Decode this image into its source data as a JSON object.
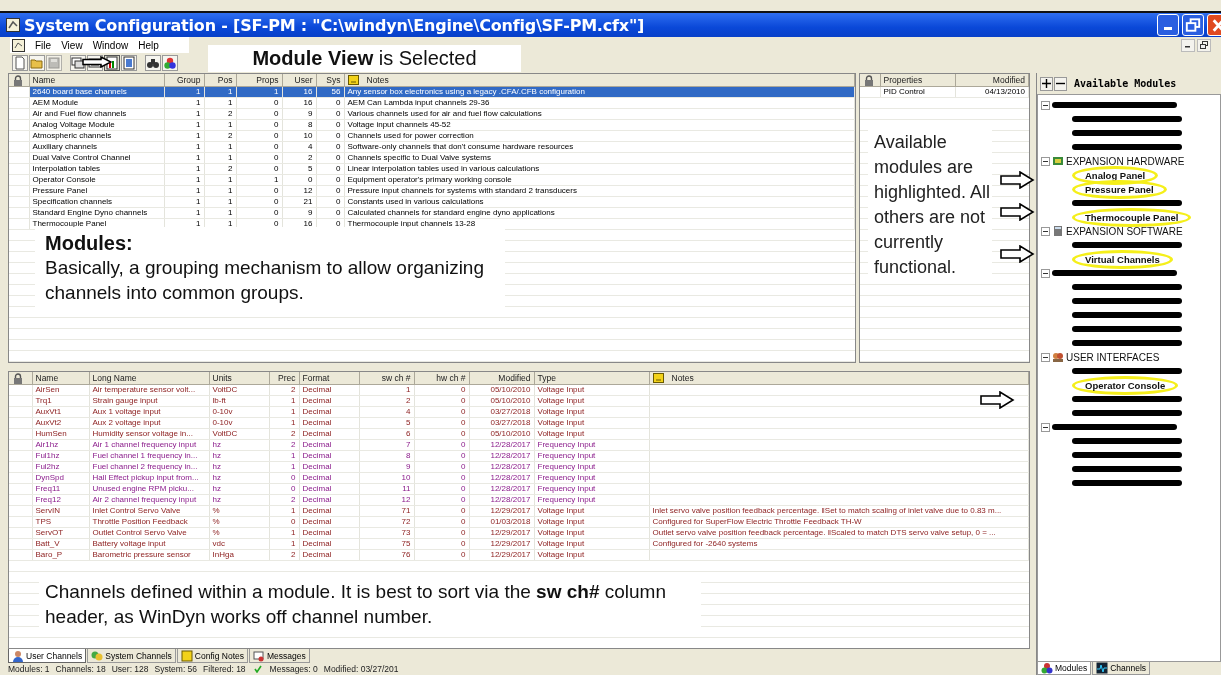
{
  "window": {
    "title": "System Configuration - [SF-PM : \"C:\\windyn\\Engine\\Config\\SF-PM.cfx\"]",
    "menu": [
      "File",
      "View",
      "Window",
      "Help"
    ]
  },
  "view_note": "**Module View** is Selected",
  "module_table": {
    "columns": [
      "Name",
      "Group",
      "Pos",
      "Props",
      "User",
      "Sys",
      "Notes"
    ],
    "rows": [
      {
        "cells": [
          "2640 board base channels",
          "1",
          "1",
          "1",
          "16",
          "56",
          "Any sensor box electronics using a legacy .CFA/.CFB configuration"
        ],
        "selected": true
      },
      {
        "cells": [
          "AEM Module",
          "1",
          "1",
          "0",
          "16",
          "0",
          "AEM Can Lambda input channels 29-36"
        ],
        "selected": false
      },
      {
        "cells": [
          "Air and Fuel flow channels",
          "1",
          "2",
          "0",
          "9",
          "0",
          "Various channels used for air and fuel flow calculations"
        ],
        "selected": false
      },
      {
        "cells": [
          "Analog Voltage Module",
          "1",
          "1",
          "0",
          "8",
          "0",
          "Voltage input channels 45-52"
        ],
        "selected": false
      },
      {
        "cells": [
          "Atmospheric channels",
          "1",
          "2",
          "0",
          "10",
          "0",
          "Channels used for power correction"
        ],
        "selected": false
      },
      {
        "cells": [
          "Auxiliary channels",
          "1",
          "1",
          "0",
          "4",
          "0",
          "Software-only channels that don't consume hardware resources"
        ],
        "selected": false
      },
      {
        "cells": [
          "Dual Valve Control Channel",
          "1",
          "1",
          "0",
          "2",
          "0",
          "Channels specific to Dual Valve systems"
        ],
        "selected": false
      },
      {
        "cells": [
          "Interpolation tables",
          "1",
          "2",
          "0",
          "5",
          "0",
          "Linear interpolation tables used in various calculations"
        ],
        "selected": false
      },
      {
        "cells": [
          "Operator Console",
          "1",
          "1",
          "1",
          "0",
          "0",
          "Equipment operator's primary working console"
        ],
        "selected": false
      },
      {
        "cells": [
          "Pressure Panel",
          "1",
          "1",
          "0",
          "12",
          "0",
          "Pressure input channels for systems with standard 2 transducers"
        ],
        "selected": false
      },
      {
        "cells": [
          "Specification channels",
          "1",
          "1",
          "0",
          "21",
          "0",
          "Constants used in various calculations"
        ],
        "selected": false
      },
      {
        "cells": [
          "Standard Engine Dyno channels",
          "1",
          "1",
          "0",
          "9",
          "0",
          "Calculated channels for standard engine dyno applications"
        ],
        "selected": false
      },
      {
        "cells": [
          "Thermocouple Panel",
          "1",
          "1",
          "0",
          "16",
          "0",
          "Thermocouple input channels 13-28"
        ],
        "selected": false
      }
    ]
  },
  "modules_note": {
    "heading": "Modules:",
    "body": "Basically, a grouping mechanism to allow organizing channels into common groups."
  },
  "properties_table": {
    "columns": [
      "Properties",
      "Modified"
    ],
    "rows": [
      [
        "PID Control",
        "04/13/2010"
      ]
    ]
  },
  "available_note": "Available modules are highlighted. All others are not currently functional.",
  "channel_table": {
    "columns": [
      "Name",
      "Long Name",
      "Units",
      "Prec",
      "Format",
      "sw ch #",
      "hw ch #",
      "Modified",
      "Type",
      "Notes"
    ],
    "rows": [
      {
        "cells": [
          "AirSen",
          "Air temperature sensor volt...",
          "VoltDC",
          "2",
          "Decimal",
          "1",
          "0",
          "05/10/2010",
          "Voltage Input",
          ""
        ],
        "kind": "voltage"
      },
      {
        "cells": [
          "Trq1",
          "Strain gauge input",
          "lb-ft",
          "1",
          "Decimal",
          "2",
          "0",
          "05/10/2010",
          "Voltage Input",
          ""
        ],
        "kind": "voltage"
      },
      {
        "cells": [
          "AuxVt1",
          "Aux 1 voltage input",
          "0-10v",
          "1",
          "Decimal",
          "4",
          "0",
          "03/27/2018",
          "Voltage Input",
          ""
        ],
        "kind": "voltage"
      },
      {
        "cells": [
          "AuxVt2",
          "Aux 2 voltage input",
          "0-10v",
          "1",
          "Decimal",
          "5",
          "0",
          "03/27/2018",
          "Voltage Input",
          ""
        ],
        "kind": "voltage"
      },
      {
        "cells": [
          "HumSen",
          "Humidity sensor voltage in...",
          "VoltDC",
          "2",
          "Decimal",
          "6",
          "0",
          "05/10/2010",
          "Voltage Input",
          ""
        ],
        "kind": "voltage"
      },
      {
        "cells": [
          "Air1hz",
          "Air 1 channel frequency input",
          "hz",
          "2",
          "Decimal",
          "7",
          "0",
          "12/28/2017",
          "Frequency Input",
          ""
        ],
        "kind": "frequency"
      },
      {
        "cells": [
          "Ful1hz",
          "Fuel channel 1 frequency in...",
          "hz",
          "1",
          "Decimal",
          "8",
          "0",
          "12/28/2017",
          "Frequency Input",
          ""
        ],
        "kind": "frequency"
      },
      {
        "cells": [
          "Ful2hz",
          "Fuel channel 2 frequency in...",
          "hz",
          "1",
          "Decimal",
          "9",
          "0",
          "12/28/2017",
          "Frequency Input",
          ""
        ],
        "kind": "frequency"
      },
      {
        "cells": [
          "DynSpd",
          "Hall Effect pickup input from...",
          "hz",
          "0",
          "Decimal",
          "10",
          "0",
          "12/28/2017",
          "Frequency Input",
          ""
        ],
        "kind": "frequency"
      },
      {
        "cells": [
          "Freq11",
          "Unused engine RPM picku...",
          "hz",
          "0",
          "Decimal",
          "11",
          "0",
          "12/28/2017",
          "Frequency Input",
          ""
        ],
        "kind": "frequency"
      },
      {
        "cells": [
          "Freq12",
          "Air 2 channel frequency input",
          "hz",
          "2",
          "Decimal",
          "12",
          "0",
          "12/28/2017",
          "Frequency Input",
          ""
        ],
        "kind": "frequency"
      },
      {
        "cells": [
          "ServIN",
          "Inlet Control Servo Valve",
          "%",
          "1",
          "Decimal",
          "71",
          "0",
          "12/29/2017",
          "Voltage Input",
          "Inlet servo valve position feedback percentage. ‖Set to match scaling of inlet valve due to 0.83 m..."
        ],
        "kind": "voltage"
      },
      {
        "cells": [
          "TPS",
          "Throttle Position Feedback",
          "%",
          "0",
          "Decimal",
          "72",
          "0",
          "01/03/2018",
          "Voltage Input",
          "Configured for  SuperFlow Electric Throttle Feedback TH-W"
        ],
        "kind": "voltage"
      },
      {
        "cells": [
          "ServOT",
          "Outlet Control Servo Valve",
          "%",
          "1",
          "Decimal",
          "73",
          "0",
          "12/29/2017",
          "Voltage Input",
          "Outlet servo valve position feedback percentage. ‖Scaled to match DTS servo valve setup, 0 = ..."
        ],
        "kind": "voltage"
      },
      {
        "cells": [
          "Batt_V",
          "Battery voltage input",
          "vdc",
          "1",
          "Decimal",
          "75",
          "0",
          "12/29/2017",
          "Voltage Input",
          "Configured for -2640 systems"
        ],
        "kind": "voltage"
      },
      {
        "cells": [
          "Baro_P",
          "Barometric pressure sensor",
          "InHga",
          "2",
          "Decimal",
          "76",
          "0",
          "12/29/2017",
          "Voltage Input",
          ""
        ],
        "kind": "voltage"
      }
    ]
  },
  "channels_note": "Channels defined within a module. It is best to sort via the **sw ch#** column header, as WinDyn works off channel number.",
  "bottom_tabs": [
    {
      "label": "User Channels",
      "selected": true
    },
    {
      "label": "System Channels",
      "selected": false
    },
    {
      "label": "Config Notes",
      "selected": false
    },
    {
      "label": "Messages",
      "selected": false
    }
  ],
  "status_bar": [
    "Modules: 1",
    "Channels: 18",
    "User: 128",
    "System: 56",
    "Filtered: 18",
    "Messages: 0",
    "Modified: 03/27/201"
  ],
  "modules_panel": {
    "title": "Available Modules",
    "tree": [
      {
        "kind": "redacted",
        "children": [
          {
            "kind": "redacted"
          },
          {
            "kind": "redacted"
          },
          {
            "kind": "redacted"
          }
        ]
      },
      {
        "kind": "group",
        "label": "EXPANSION HARDWARE",
        "children": [
          {
            "kind": "item",
            "label": "Analog Panel",
            "highlighted": true
          },
          {
            "kind": "item",
            "label": "Pressure Panel",
            "highlighted": true
          },
          {
            "kind": "redacted"
          },
          {
            "kind": "item",
            "label": "Thermocouple Panel",
            "highlighted": true
          }
        ]
      },
      {
        "kind": "group",
        "label": "EXPANSION SOFTWARE",
        "children": [
          {
            "kind": "redacted"
          },
          {
            "kind": "item",
            "label": "Virtual Channels",
            "highlighted": true
          }
        ]
      },
      {
        "kind": "redacted",
        "children": [
          {
            "kind": "redacted"
          },
          {
            "kind": "redacted"
          },
          {
            "kind": "redacted"
          },
          {
            "kind": "redacted"
          },
          {
            "kind": "redacted"
          }
        ]
      },
      {
        "kind": "group",
        "label": "USER INTERFACES",
        "children": [
          {
            "kind": "redacted"
          },
          {
            "kind": "item",
            "label": "Operator Console",
            "highlighted": true
          },
          {
            "kind": "redacted"
          },
          {
            "kind": "redacted"
          }
        ]
      },
      {
        "kind": "redacted",
        "children": [
          {
            "kind": "redacted"
          },
          {
            "kind": "redacted"
          },
          {
            "kind": "redacted"
          },
          {
            "kind": "redacted"
          }
        ]
      }
    ],
    "tabs": [
      {
        "label": "Modules",
        "selected": true
      },
      {
        "label": "Channels",
        "selected": false
      }
    ]
  }
}
